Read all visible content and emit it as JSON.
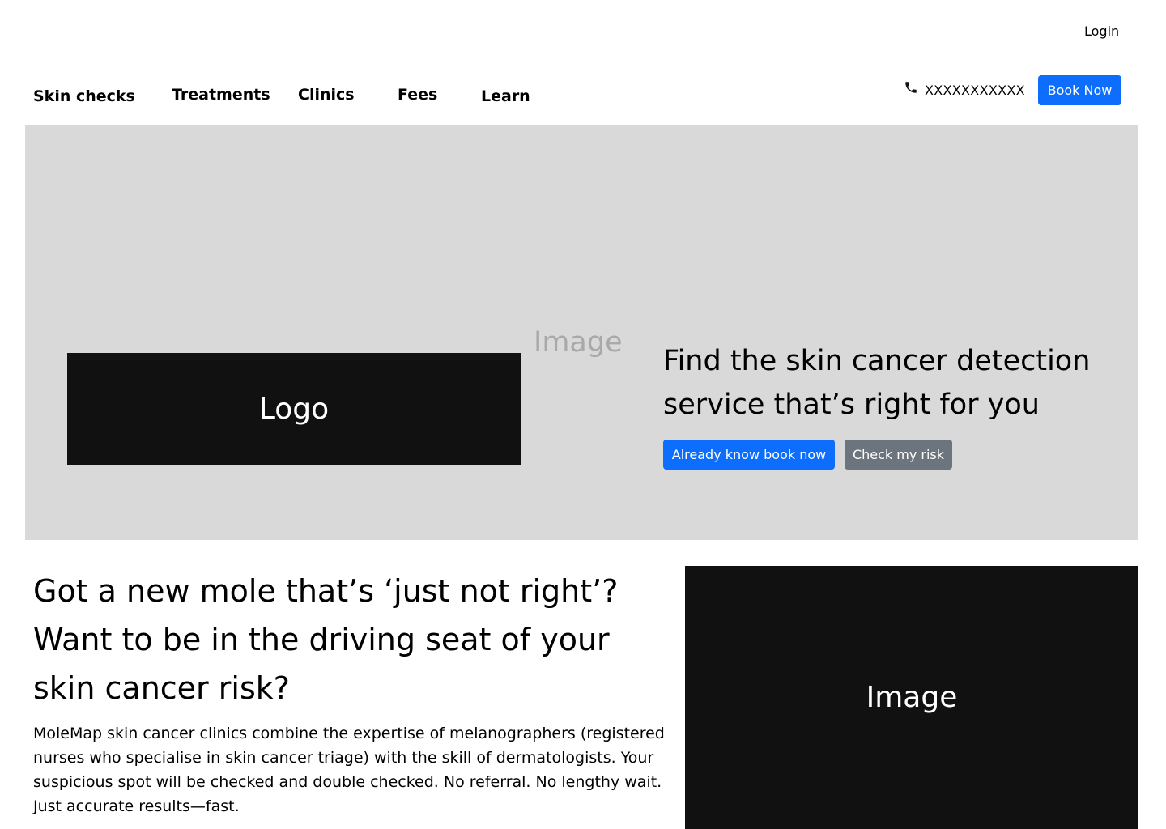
{
  "header": {
    "login_label": "Login",
    "nav": [
      {
        "label": "Skin checks"
      },
      {
        "label": "Treatments"
      },
      {
        "label": "Clinics"
      },
      {
        "label": "Fees"
      },
      {
        "label": "Learn"
      }
    ],
    "phone": {
      "icon": "phone-icon",
      "number": "XXXXXXXXXXX"
    },
    "book_now_label": "Book Now"
  },
  "hero": {
    "image_placeholder": "Image",
    "logo_label": "Logo",
    "heading": "Find the skin cancer detection service that’s right for you",
    "book_button_label": "Already  know book now",
    "risk_button_label": "Check my risk"
  },
  "intro": {
    "heading": "Got a new mole that’s ‘just not right’? Want to be in the driving seat of your skin cancer risk?",
    "body": "MoleMap skin cancer clinics combine the expertise of melanographers (registered nurses who specialise in skin cancer triage) with the skill of dermatologists. Your suspicious spot will be checked and double checked. No referral. No lengthy wait. Just  accurate results—fast.",
    "image_label": "Image"
  },
  "colors": {
    "primary": "#0d6efd",
    "secondary": "#6c757d",
    "hero_bg": "#d9d9d9",
    "placeholder_dark": "#111111"
  }
}
